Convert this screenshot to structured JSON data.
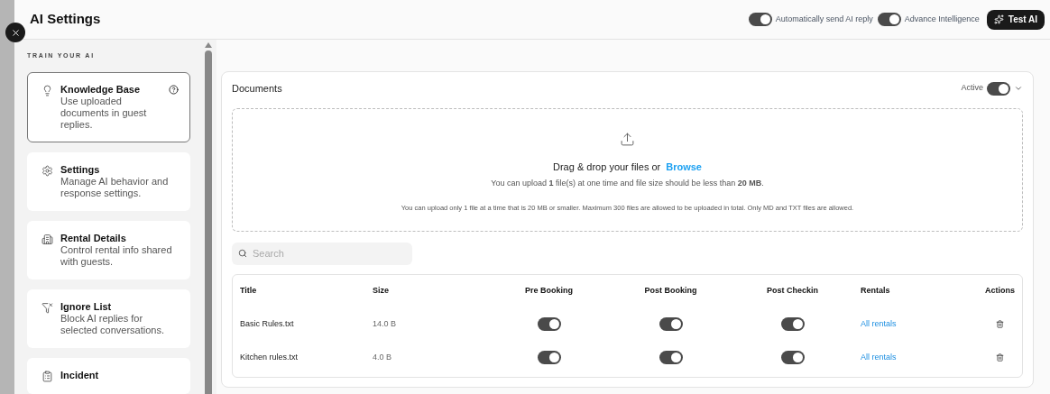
{
  "header": {
    "title": "AI Settings",
    "toggles": [
      {
        "label": "Automatically send AI reply",
        "on": true
      },
      {
        "label": "Advance Intelligence",
        "on": true
      }
    ],
    "test_button": "Test AI"
  },
  "sidebar": {
    "heading": "TRAIN YOUR AI",
    "items": [
      {
        "kind": "bulb",
        "title": "Knowledge Base",
        "description": "Use uploaded documents in guest replies.",
        "selected": true,
        "help": true
      },
      {
        "kind": "gear",
        "title": "Settings",
        "description": "Manage AI behavior and response settings.",
        "selected": false,
        "help": false
      },
      {
        "kind": "building",
        "title": "Rental Details",
        "description": "Control rental info shared with guests.",
        "selected": false,
        "help": false
      },
      {
        "kind": "filter",
        "title": "Ignore List",
        "description": "Block AI replies for selected conversations.",
        "selected": false,
        "help": false
      },
      {
        "kind": "clipboard",
        "title": "Incident",
        "selected": false,
        "help": false
      }
    ]
  },
  "documents": {
    "title": "Documents",
    "status_label": "Active",
    "active": true,
    "upload": {
      "prompt": "Drag & drop your files or",
      "browse": "Browse",
      "limit": "You can upload **1** file(s) at one time and file size should be less than **20 MB**.",
      "note": "You can upload only 1 file at a time that is 20 MB or smaller. Maximum 300 files are allowed to be uploaded in total. Only MD and TXT files are allowed."
    },
    "search": {
      "placeholder": "Search"
    },
    "table": {
      "columns": [
        "Title",
        "Size",
        "Pre Booking",
        "Post Booking",
        "Post Checkin",
        "Rentals",
        "Actions"
      ],
      "rows": [
        {
          "title": "Basic Rules.txt",
          "size": "14.0 B",
          "pre_booking": true,
          "post_booking": true,
          "post_checkin": true,
          "rentals": "All rentals"
        },
        {
          "title": "Kitchen rules.txt",
          "size": "4.0 B",
          "pre_booking": true,
          "post_booking": true,
          "post_checkin": true,
          "rentals": "All rentals"
        }
      ]
    }
  }
}
